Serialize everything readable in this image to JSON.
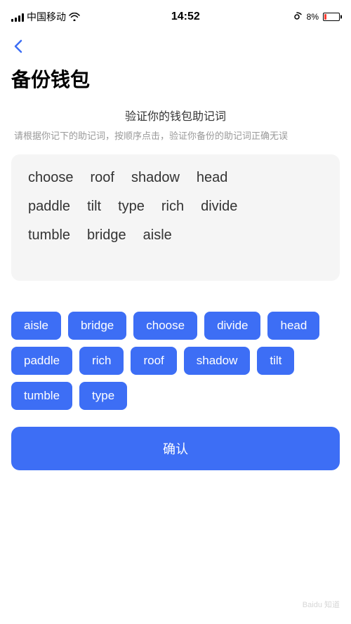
{
  "statusBar": {
    "carrier": "中国移动",
    "time": "14:52",
    "batteryPercent": "8%",
    "batteryLow": true
  },
  "backButton": {
    "label": "‹"
  },
  "pageTitle": "备份钱包",
  "verifySection": {
    "title": "验证你的钱包助记词",
    "description": "请根据你记下的助记词，按顺序点击，验证你备份的助记词正确无误"
  },
  "displayWords": {
    "row1": [
      "choose",
      "roof",
      "shadow",
      "head"
    ],
    "row2": [
      "paddle",
      "tilt",
      "type",
      "rich",
      "divide"
    ],
    "row3": [
      "tumble",
      "bridge",
      "aisle"
    ]
  },
  "wordButtons": [
    "aisle",
    "bridge",
    "choose",
    "divide",
    "head",
    "paddle",
    "rich",
    "roof",
    "shadow",
    "tilt",
    "tumble",
    "type"
  ],
  "confirmButton": {
    "label": "确认"
  },
  "watermark": "Baidu 知道"
}
